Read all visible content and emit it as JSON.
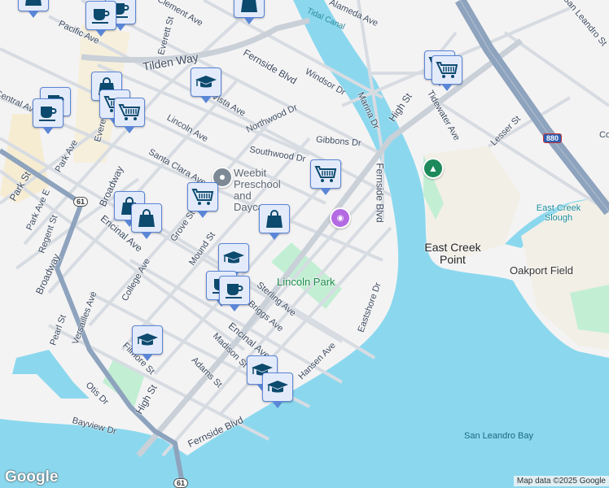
{
  "map": {
    "colors": {
      "water": "#8bd8ee",
      "land": "#f4f3f4",
      "park": "#c2efd3",
      "road": "#d7dce2",
      "highway": "#8ea3bd",
      "marker_bg": "#e3ebfb",
      "marker_border": "#5b86d6",
      "icon": "#0c4a6e"
    },
    "streets": [
      "Pacific Ave",
      "Everett St",
      "Clement Ave",
      "Tilden Way",
      "Fernside Blvd",
      "Windsor Dr",
      "Marina Dr",
      "Alameda Ave",
      "High St",
      "Tidewater Ave",
      "Lesser St",
      "San Leandro St",
      "Central Ave",
      "Vista Ave",
      "Lincoln Ave",
      "Northwood Dr",
      "Gibbons Dr",
      "Southwood Dr",
      "Santa Clara Ave",
      "Park Ave",
      "Park St",
      "Broadway",
      "Park Ave E",
      "Regent St",
      "Encinal Ave",
      "Grove St",
      "Mound St",
      "Fernside Blvd",
      "College Ave",
      "Sterling Ave",
      "Briggs Ave",
      "Pearl St",
      "Versailles Ave",
      "Broadway",
      "Filmore St",
      "Adams St",
      "Madison St",
      "Encinal Ave",
      "Hansen Ave",
      "Eastshore Dr",
      "High St",
      "Otis Dr",
      "Bayview Dr",
      "Fernside Blvd",
      "Everett St",
      "Co"
    ],
    "places": {
      "tidal_canal": "Tidal Canal",
      "lincoln_park": "Lincoln Park",
      "east_creek_point": "East Creek Point",
      "east_creek_slough": "East Creek Slough",
      "oakport_field": "Oakport Field",
      "san_leandro_bay": "San Leandro Bay",
      "weebit": "Weebit Preschool and Daycare"
    },
    "shields": {
      "i880": "880",
      "ca61": "61"
    },
    "attribution": "Map data ©2025 Google",
    "logo": "Google",
    "markers": [
      "coffee",
      "coffee",
      "shopping-bag",
      "shopping-bag",
      "shopping-cart",
      "shopping-cart",
      "graduation-cap",
      "shopping-bag",
      "coffee",
      "coffee",
      "shopping-cart",
      "shopping-cart",
      "shopping-cart",
      "shopping-bag",
      "shopping-bag",
      "shopping-bag",
      "shopping-bag",
      "graduation-cap",
      "coffee",
      "coffee",
      "graduation-cap",
      "graduation-cap",
      "graduation-cap"
    ]
  }
}
